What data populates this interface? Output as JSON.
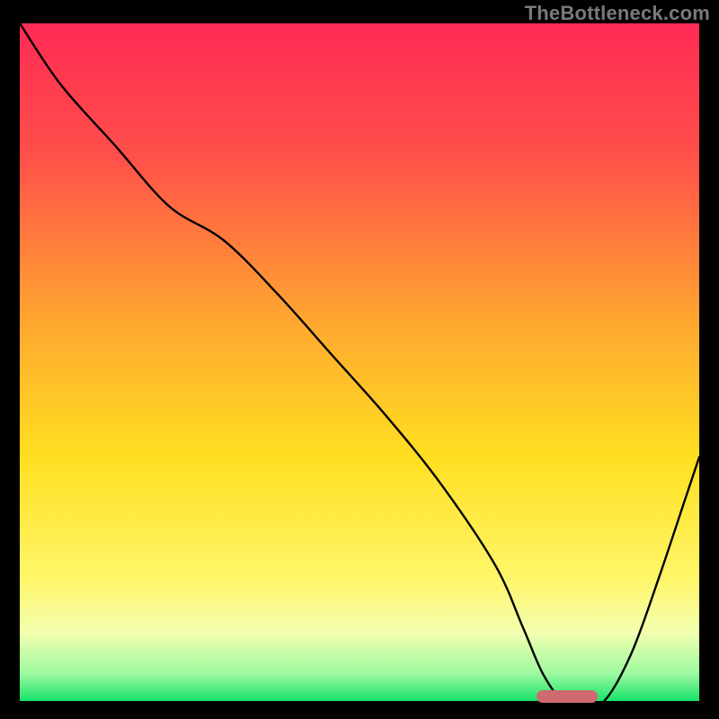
{
  "watermark": "TheBottleneck.com",
  "chart_data": {
    "type": "line",
    "title": "",
    "xlabel": "",
    "ylabel": "",
    "xlim": [
      0,
      100
    ],
    "ylim": [
      0,
      100
    ],
    "gradient_stops": [
      {
        "offset": 0,
        "color": "#ff2a55"
      },
      {
        "offset": 20,
        "color": "#ff5149"
      },
      {
        "offset": 44,
        "color": "#ffa730"
      },
      {
        "offset": 64,
        "color": "#ffdf20"
      },
      {
        "offset": 82,
        "color": "#fff66a"
      },
      {
        "offset": 90,
        "color": "#f2ffb0"
      },
      {
        "offset": 96,
        "color": "#9cf9a0"
      },
      {
        "offset": 100,
        "color": "#17e36a"
      }
    ],
    "series": [
      {
        "name": "bottleneck-curve",
        "x": [
          0,
          6,
          14,
          22,
          30,
          38,
          46,
          54,
          62,
          70,
          74,
          77,
          80,
          83,
          86,
          90,
          94,
          98,
          100
        ],
        "y": [
          100,
          91,
          82,
          73,
          68,
          60,
          51,
          42,
          32,
          20,
          11,
          4,
          0,
          0,
          0,
          7,
          18,
          30,
          36
        ]
      }
    ],
    "marker": {
      "x_start": 76,
      "x_end": 85,
      "y": 0,
      "color": "#cf6a6e"
    }
  }
}
